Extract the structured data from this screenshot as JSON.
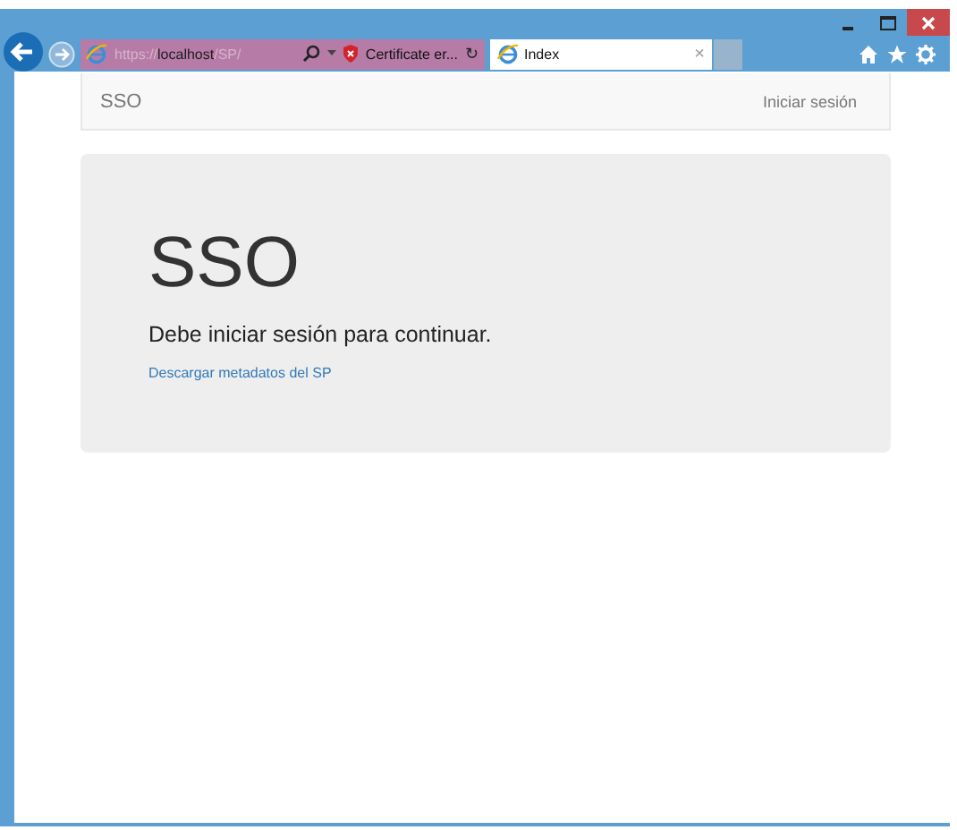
{
  "browser": {
    "address": {
      "scheme": "https://",
      "host": "localhost",
      "path": "/SP/"
    },
    "certificate_warning": "Certificate er...",
    "refresh_glyph": "↻",
    "tabs": [
      {
        "label": "Index",
        "selected": true,
        "close_glyph": "×"
      }
    ]
  },
  "navbar": {
    "brand": "SSO",
    "link": "Iniciar sesión"
  },
  "jumbotron": {
    "title": "SSO",
    "lead": "Debe iniciar sesión para continuar.",
    "link": "Descargar metadatos del SP"
  }
}
